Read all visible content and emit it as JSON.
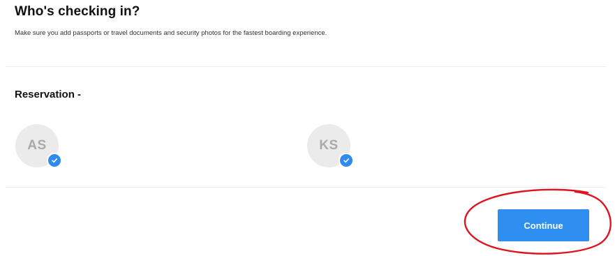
{
  "header": {
    "title": "Who's checking in?",
    "subtitle": "Make sure you add passports or travel documents and security photos for the fastest boarding experience."
  },
  "reservation": {
    "label": "Reservation -"
  },
  "passengers": [
    {
      "initials": "AS",
      "selected": true
    },
    {
      "initials": "KS",
      "selected": true
    }
  ],
  "actions": {
    "continue_label": "Continue"
  },
  "colors": {
    "accent": "#2f8ff0",
    "avatar_bg": "#ebebeb",
    "avatar_text": "#a9a9a9",
    "annotation": "#e0141e"
  },
  "icons": {
    "selected": "checkmark-icon"
  }
}
